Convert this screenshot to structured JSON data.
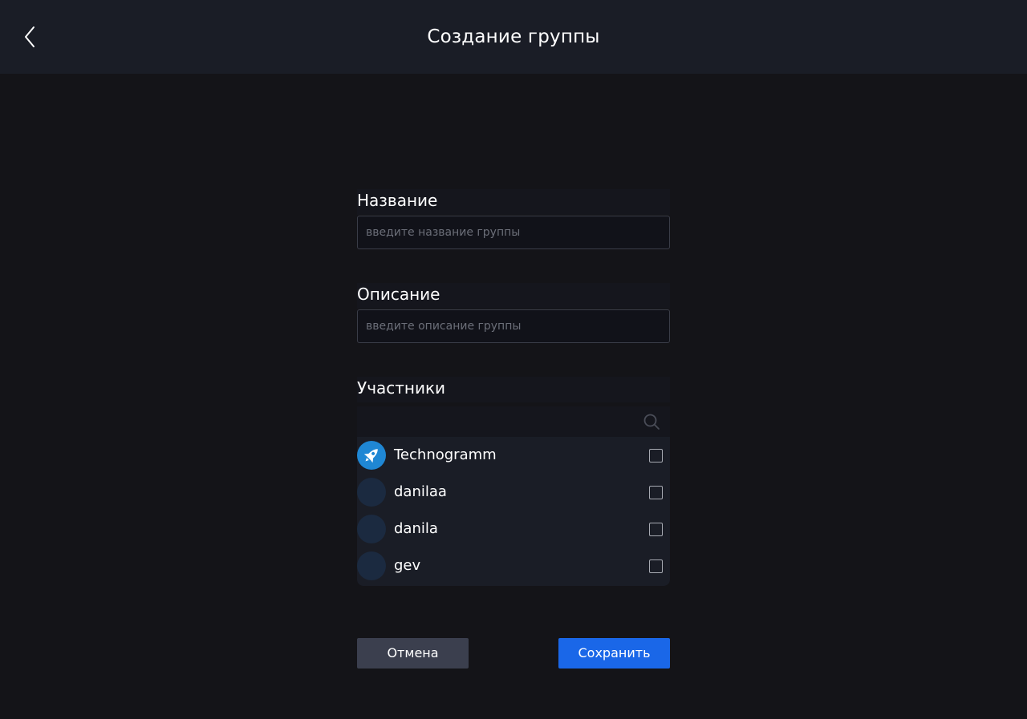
{
  "header": {
    "title": "Создание группы",
    "back_icon": "chevron-left-icon"
  },
  "form": {
    "name": {
      "label": "Название",
      "placeholder": "введите название группы",
      "value": ""
    },
    "description": {
      "label": "Описание",
      "placeholder": "введите описание группы",
      "value": ""
    },
    "members": {
      "label": "Участники",
      "search_icon": "search-icon",
      "items": [
        {
          "name": "Technogramm",
          "avatar": "rocket-icon",
          "checked": false
        },
        {
          "name": "danilaa",
          "avatar": "avatar-placeholder",
          "checked": false
        },
        {
          "name": "danila",
          "avatar": "avatar-placeholder",
          "checked": false
        },
        {
          "name": "gev",
          "avatar": "avatar-placeholder",
          "checked": false
        }
      ]
    }
  },
  "actions": {
    "cancel_label": "Отмена",
    "save_label": "Сохранить"
  },
  "colors": {
    "background": "#141418",
    "header": "#1a1d26",
    "accent": "#1a67e8",
    "cancel": "#3b3f4e",
    "brand_avatar": "#1f87d4"
  }
}
